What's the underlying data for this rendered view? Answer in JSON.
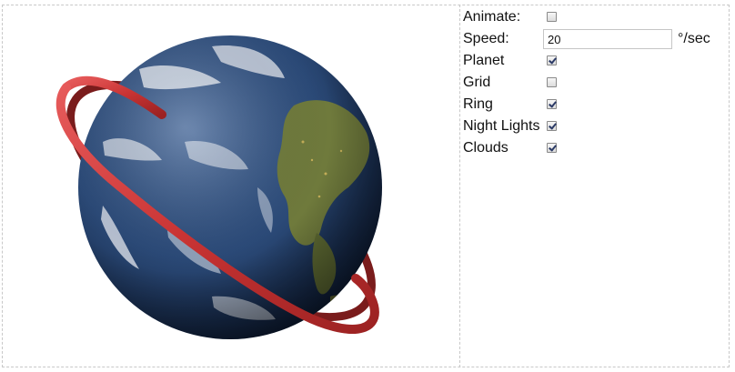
{
  "controls": {
    "animate": {
      "label": "Animate:",
      "checked": false
    },
    "speed": {
      "label": "Speed:",
      "value": "20",
      "unit": "°/sec"
    },
    "planet": {
      "label": "Planet",
      "checked": true
    },
    "grid": {
      "label": "Grid",
      "checked": false
    },
    "ring": {
      "label": "Ring",
      "checked": true
    },
    "night_lights": {
      "label": "Night Lights",
      "checked": true
    },
    "clouds": {
      "label": "Clouds",
      "checked": true
    }
  },
  "scene": {
    "ocean_color": "#2b4a78",
    "land_color": "#6f7a3c",
    "cloud_color": "#f2f4f8",
    "ring_color": "#d64040"
  }
}
